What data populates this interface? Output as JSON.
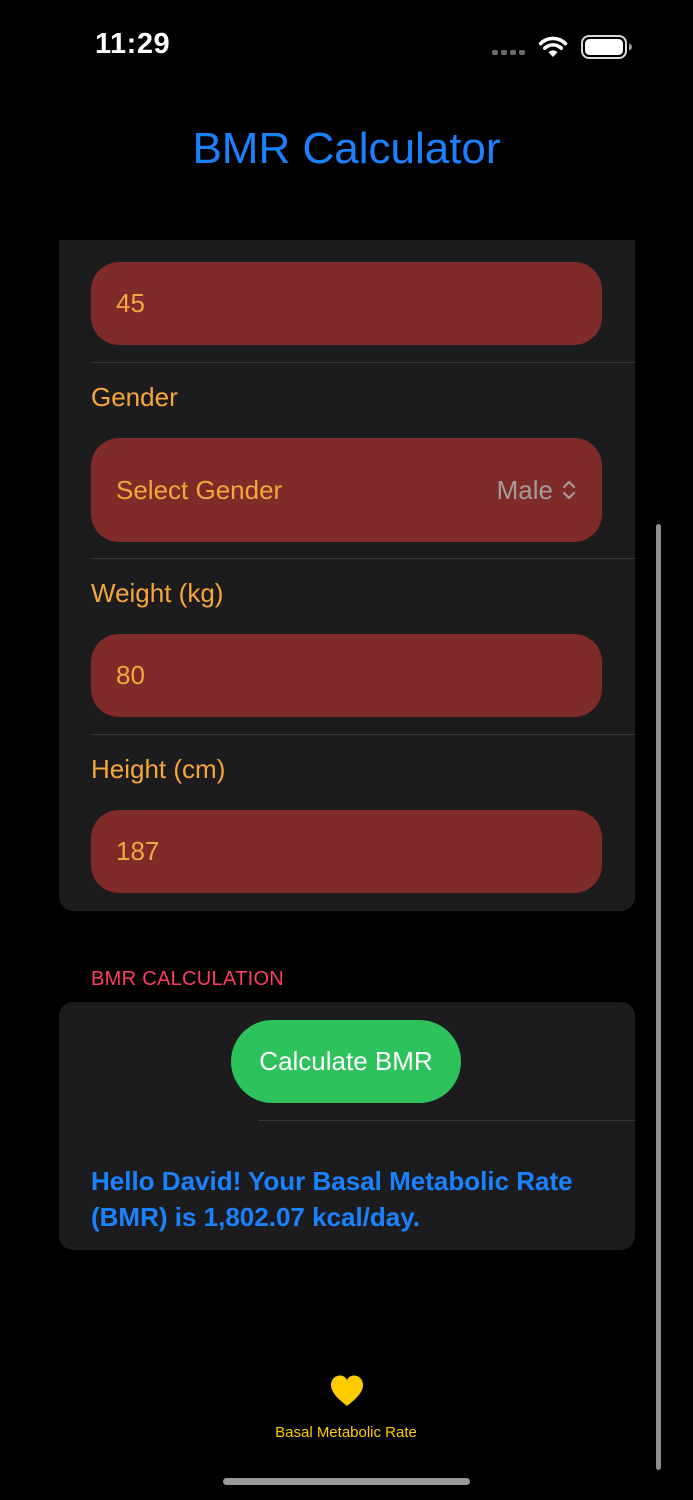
{
  "status_bar": {
    "time": "11:29",
    "wifi_icon": "wifi-icon",
    "battery_icon": "battery-icon"
  },
  "nav": {
    "title": "BMR Calculator"
  },
  "form": {
    "age_value": "45",
    "gender_label": "Gender",
    "gender_select_label": "Select Gender",
    "gender_value": "Male",
    "weight_label": "Weight (kg)",
    "weight_value": "80",
    "height_label": "Height (cm)",
    "height_value": "187"
  },
  "calculation": {
    "section_header": "BMR CALCULATION",
    "button_label": "Calculate BMR",
    "result": "Hello David! Your Basal Metabolic Rate (BMR) is 1,802.07 kcal/day."
  },
  "tab_bar": {
    "items": [
      {
        "label": "Basal Metabolic Rate",
        "icon": "heart-icon"
      }
    ]
  },
  "colors": {
    "accent_blue": "#1a82ff",
    "field_background": "#7f2b2a",
    "field_text": "#f6a63a",
    "button_green": "#2ec25c",
    "section_header": "#ff3b64",
    "tab_active": "#ffcc00"
  }
}
